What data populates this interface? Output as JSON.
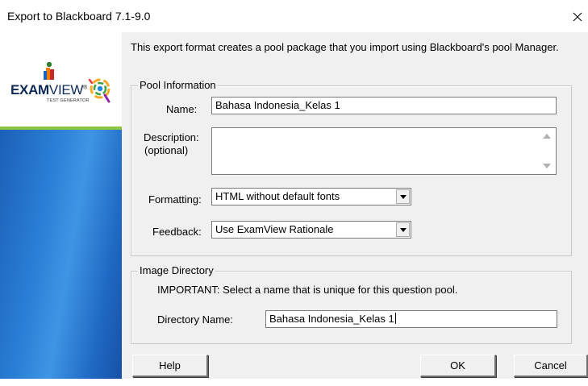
{
  "window": {
    "title": "Export to Blackboard 7.1-9.0"
  },
  "brand": {
    "logo_bold": "EXAM",
    "logo_light": "VIEW",
    "logo_mark": "®",
    "logo_sub": "TEST GENERATOR",
    "accent_green": "#8cc63f",
    "panel_blue": "#2a7fd6"
  },
  "intro": "This export format creates a pool package that you import using Blackboard's pool Manager.",
  "pool_information": {
    "title": "Pool Information",
    "name_label": "Name:",
    "name_value": "Bahasa Indonesia_Kelas 1",
    "description_label_1": "Description:",
    "description_label_2": "(optional)",
    "description_value": "",
    "formatting_label": "Formatting:",
    "formatting_value": "HTML without default fonts",
    "feedback_label": "Feedback:",
    "feedback_value": "Use ExamView Rationale"
  },
  "image_directory": {
    "title": "Image Directory",
    "important_note": "IMPORTANT: Select a name that is unique for this question pool.",
    "directory_label": "Directory Name:",
    "directory_value": "Bahasa Indonesia_Kelas 1"
  },
  "buttons": {
    "help": "Help",
    "ok": "OK",
    "cancel": "Cancel"
  },
  "icons": {
    "close": "close-icon",
    "scroll_up": "scroll-up-arrow-icon",
    "scroll_down": "scroll-down-arrow-icon",
    "dropdown": "chevron-down-icon",
    "logo_figure": "examview-figure-icon",
    "logo_swirl": "examview-swirl-icon"
  }
}
